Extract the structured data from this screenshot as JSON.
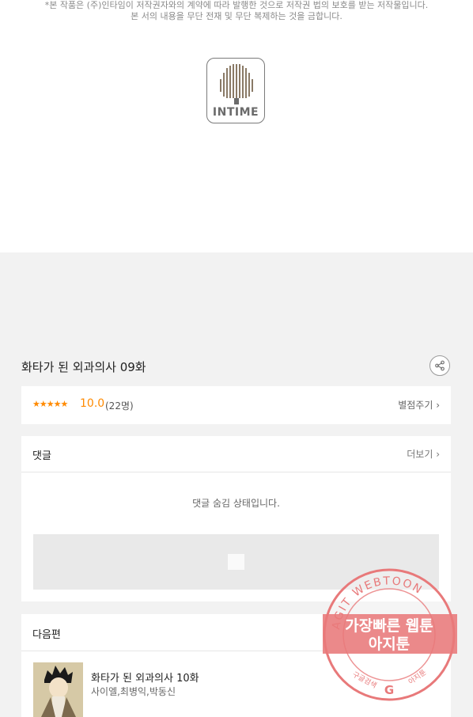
{
  "copyright": {
    "line1": "*본 작품은 (주)인타임이 저작권자와의 계약에 따라 발행한 것으로 저작권 법의 보호를 받는 저작물입니다.",
    "line2": "본 서의 내용을 무단 전재 및 무단 복제하는 것을 금합니다."
  },
  "publisher_logo": {
    "text": "INTIME"
  },
  "episode": {
    "title": "화타가 된 외과의사 09화",
    "share_icon": "share-icon"
  },
  "rating": {
    "stars": "★★★★★",
    "score": "10.0",
    "count": "(22명)",
    "rate_button": "별점주기 ›"
  },
  "comments": {
    "title": "댓글",
    "more": "더보기 ›",
    "hidden_message": "댓글 숨김 상태입니다."
  },
  "next_episode": {
    "section_title": "다음편",
    "title": "화타가 된 외과의사 10화",
    "authors": "사이엘,최병익,박동신"
  },
  "watermark": {
    "ring_text": "AGIT WEBTOON",
    "main_line1": "가장빠른 웹툰",
    "main_line2": "아지툰",
    "bottom_left": "구글검색",
    "bottom_right": "아지툰"
  },
  "colors": {
    "accent": "#ff8a00",
    "stamp": "#e8797a"
  }
}
